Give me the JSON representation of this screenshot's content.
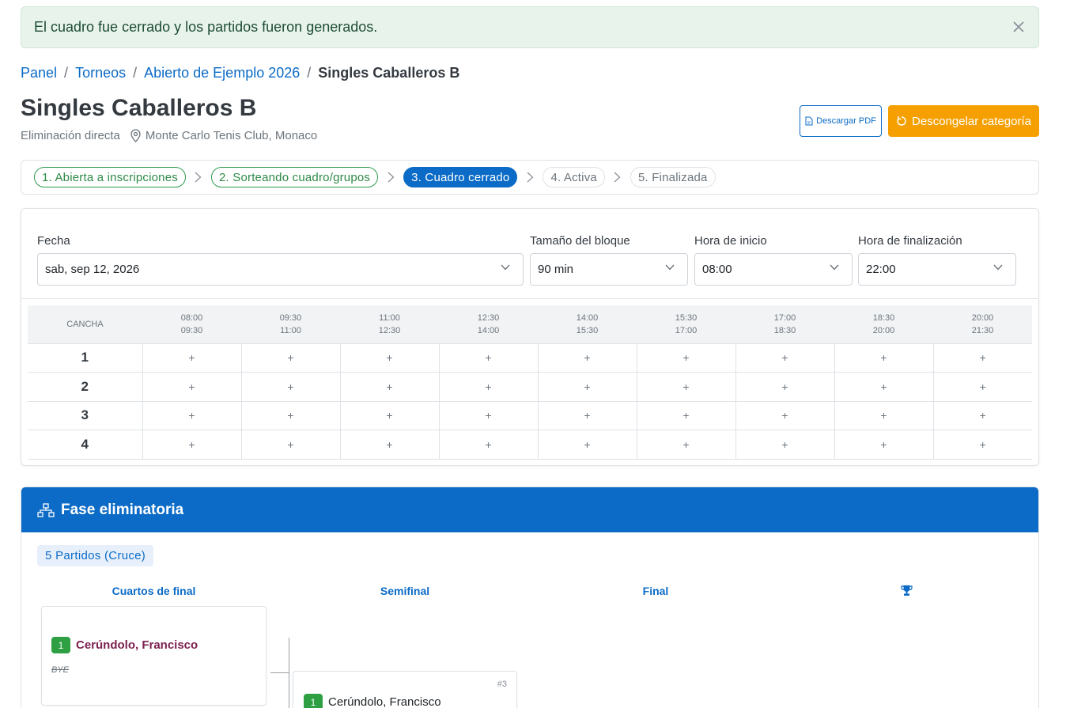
{
  "alert": {
    "message": "El cuadro fue cerrado y los partidos fueron generados."
  },
  "breadcrumb": [
    {
      "label": "Panel"
    },
    {
      "label": "Torneos"
    },
    {
      "label": "Abierto de Ejemplo 2026"
    },
    {
      "label": "Singles Caballeros B"
    }
  ],
  "category": {
    "title": "Singles Caballeros B",
    "format": "Eliminación directa",
    "location": "Monte Carlo Tenis Club, Monaco"
  },
  "actions": {
    "pdf_label": "Descargar PDF",
    "unfreeze_label": "Descongelar categoría"
  },
  "steps": [
    {
      "label": "1. Abierta a inscripciones",
      "state": "done"
    },
    {
      "label": "2. Sorteando cuadro/grupos",
      "state": "done"
    },
    {
      "label": "3. Cuadro cerrado",
      "state": "active"
    },
    {
      "label": "4. Activa",
      "state": "pending"
    },
    {
      "label": "5. Finalizada",
      "state": "pending"
    }
  ],
  "schedule": {
    "date": {
      "label": "Fecha",
      "value": "sab, sep 12, 2026"
    },
    "block": {
      "label": "Tamaño del bloque",
      "value": "90 min"
    },
    "start": {
      "label": "Hora de inicio",
      "value": "08:00"
    },
    "end": {
      "label": "Hora de finalización",
      "value": "22:00"
    },
    "court_header": "CANCHA",
    "slots": [
      {
        "from": "08:00",
        "to": "09:30"
      },
      {
        "from": "09:30",
        "to": "11:00"
      },
      {
        "from": "11:00",
        "to": "12:30"
      },
      {
        "from": "12:30",
        "to": "14:00"
      },
      {
        "from": "14:00",
        "to": "15:30"
      },
      {
        "from": "15:30",
        "to": "17:00"
      },
      {
        "from": "17:00",
        "to": "18:30"
      },
      {
        "from": "18:30",
        "to": "20:00"
      },
      {
        "from": "20:00",
        "to": "21:30"
      }
    ],
    "courts": [
      "1",
      "2",
      "3",
      "4"
    ],
    "cell_symbol": "+"
  },
  "knockout": {
    "title": "Fase eliminatoria",
    "badge": "5 Partidos (Cruce)",
    "rounds": [
      "Cuartos de final",
      "Semifinal",
      "Final"
    ],
    "qf_match": {
      "seed": "1",
      "player": "Cerúndolo, Francisco",
      "opponent": "BYE"
    },
    "sf_match": {
      "number": "#3",
      "seed": "1",
      "player": "Cerúndolo, Francisco"
    }
  },
  "colors": {
    "primary": "#0b6bc7",
    "warning": "#f5a000",
    "success": "#2ea043",
    "winner_name": "#7a1f4f"
  }
}
